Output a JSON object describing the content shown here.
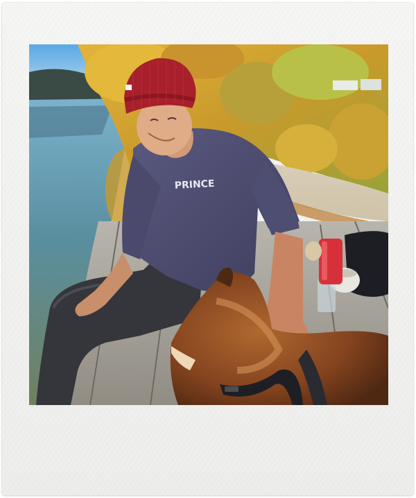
{
  "frame": {
    "style": "instant-photo",
    "border_color": "#f4f4f2"
  },
  "photo": {
    "sweater_print": "PRINCE",
    "palette": {
      "sky": "#6fb4e6",
      "lake": "#5a8fa8",
      "foliage": "#d7a637",
      "beanie": "#a8202b",
      "sweater": "#4c4b6e",
      "jeans": "#3a3a3e",
      "bench": "#a9a59c",
      "dog": "#8a4a24",
      "bottle": "#d8303a"
    }
  }
}
